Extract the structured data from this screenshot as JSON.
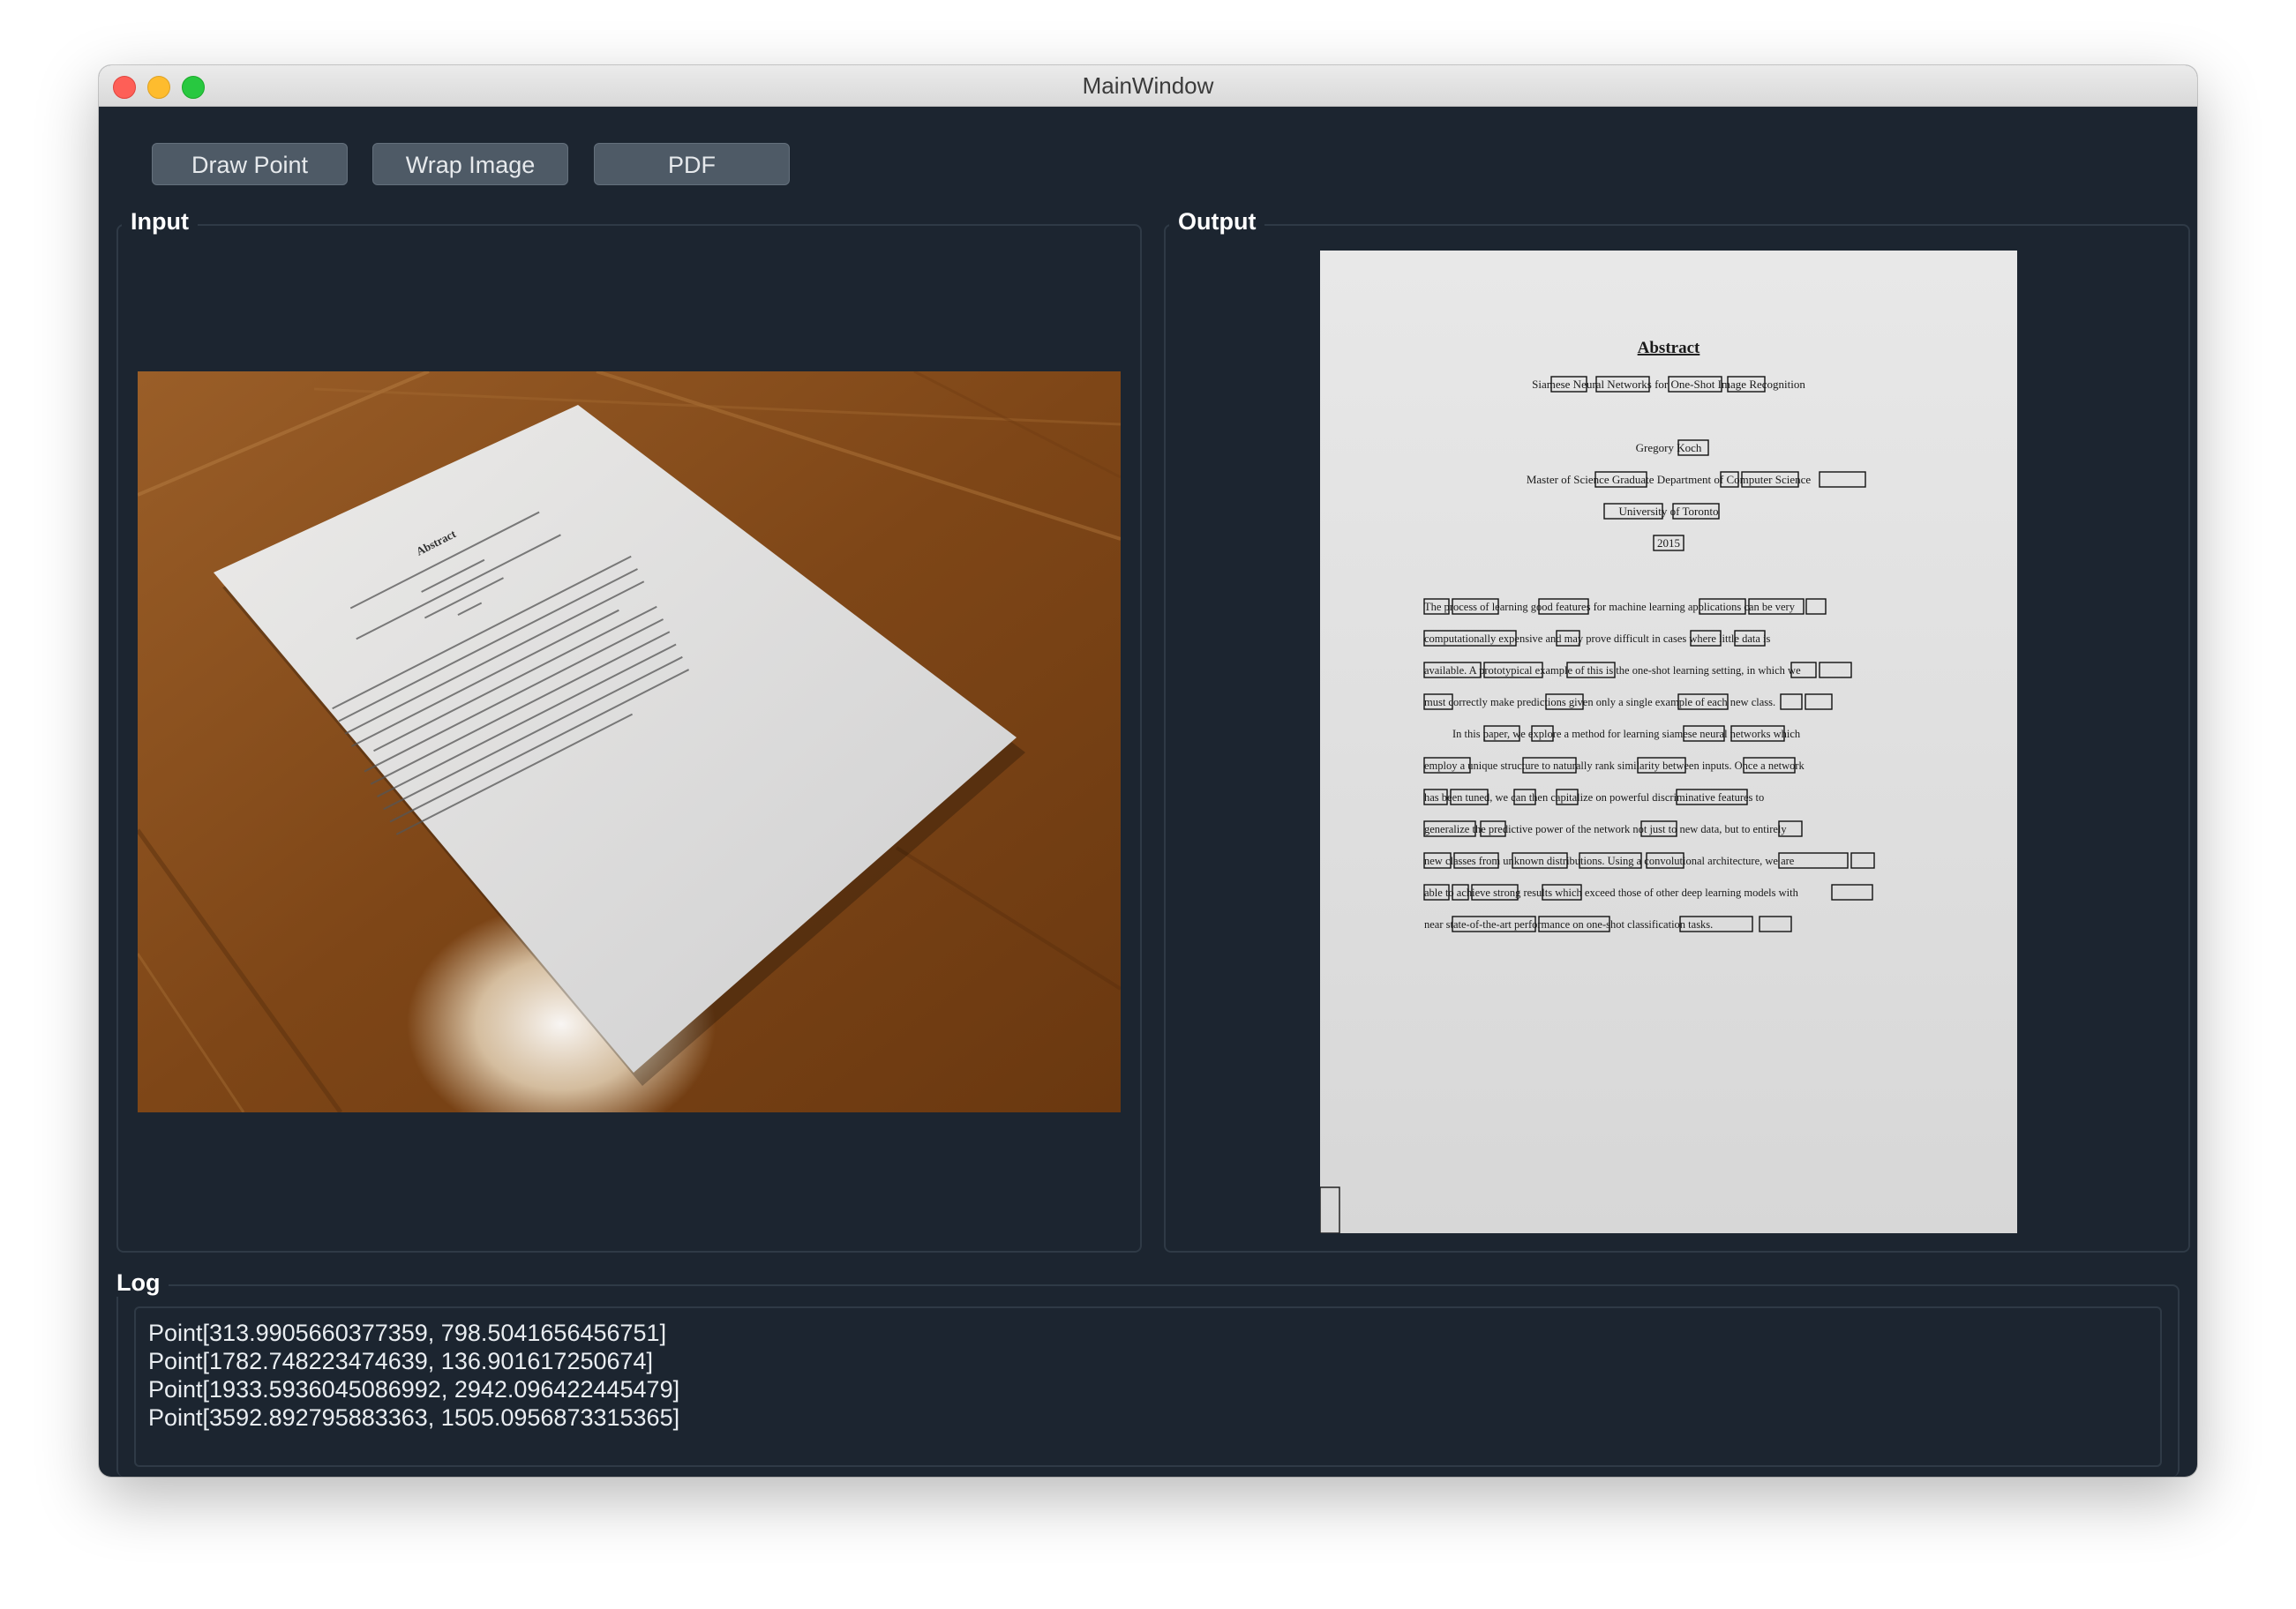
{
  "window": {
    "title": "MainWindow"
  },
  "toolbar": {
    "draw_point_label": "Draw Point",
    "wrap_image_label": "Wrap Image",
    "pdf_label": "PDF"
  },
  "panels": {
    "input_title": "Input",
    "output_title": "Output",
    "log_title": "Log"
  },
  "input_image": {
    "doc_heading": "Abstract"
  },
  "output_image": {
    "heading": "Abstract",
    "subtitle": "Siamese Neural Networks for One-Shot Image Recognition",
    "author": "Gregory Koch",
    "affiliation": "Master of Science Graduate Department of Computer Science",
    "university": "University of Toronto",
    "year": "2015",
    "paragraph1": [
      "The process of learning good features for machine learning applications can be very",
      "computationally expensive and may prove difficult in cases where little data is",
      "available. A prototypical example of this is the one-shot learning setting, in which we",
      "must correctly make predictions given only a single example of each new class."
    ],
    "paragraph2": [
      "In this paper, we explore a method for learning siamese neural networks which",
      "employ a unique structure to naturally rank similarity between inputs. Once a network",
      "has been tuned, we can then capitalize on powerful discriminative features to",
      "generalize the predictive power of the network not just to new data, but to entirely",
      "new classes from unknown distributions. Using a convolutional architecture, we are",
      "able to achieve strong results which exceed those of other deep learning models with",
      "near state-of-the-art performance on one-shot classification tasks."
    ]
  },
  "log": {
    "lines": [
      "Point[313.9905660377359, 798.5041656456751]",
      "Point[1782.748223474639, 136.901617250674]",
      "Point[1933.5936045086992, 2942.096422445479]",
      "Point[3592.892795883363, 1505.0956873315365]"
    ]
  },
  "colors": {
    "window_bg": "#1c2530",
    "button_bg": "#4e5a66",
    "group_border": "#2f3a46",
    "wood": "#8a5220",
    "paper": "#e4e3e1"
  }
}
